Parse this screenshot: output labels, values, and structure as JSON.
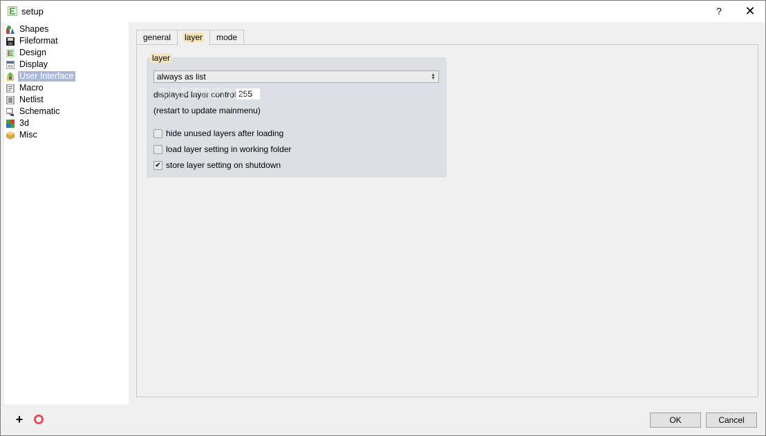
{
  "window": {
    "title": "setup",
    "help_glyph": "?",
    "close_glyph": "✕"
  },
  "sidebar": {
    "items": [
      {
        "label": "Shapes",
        "icon": "shapes-icon"
      },
      {
        "label": "Fileformat",
        "icon": "floppy-disk-icon"
      },
      {
        "label": "Design",
        "icon": "design-icon"
      },
      {
        "label": "Display",
        "icon": "display-icon"
      },
      {
        "label": "User Interface",
        "icon": "user-interface-icon",
        "selected": true
      },
      {
        "label": "Macro",
        "icon": "macro-icon"
      },
      {
        "label": "Netlist",
        "icon": "netlist-icon"
      },
      {
        "label": "Schematic",
        "icon": "schematic-icon"
      },
      {
        "label": "3d",
        "icon": "3d-icon"
      },
      {
        "label": "Misc",
        "icon": "misc-icon"
      }
    ]
  },
  "tabs": [
    {
      "label": "general",
      "active": false
    },
    {
      "label": "layer",
      "active": true
    },
    {
      "label": "mode",
      "active": false
    }
  ],
  "layer_group": {
    "title": "layer",
    "display_mode": "always as list",
    "controls_label": "displayed layer controls",
    "controls_value": "255",
    "restart_note": "(restart to update mainmenu)",
    "options": [
      {
        "label": "hide unused layers after loading",
        "checked": false
      },
      {
        "label": "load layer setting in working folder",
        "checked": false
      },
      {
        "label": "store layer setting on shutdown",
        "checked": true
      }
    ]
  },
  "buttons": {
    "ok": "OK",
    "cancel": "Cancel"
  },
  "watermark": "SOFTPEDIA",
  "colors": {
    "selection": "#aab8d4",
    "tab_highlight": "#f7e6b5",
    "group_bg": "#dcdfe4"
  }
}
